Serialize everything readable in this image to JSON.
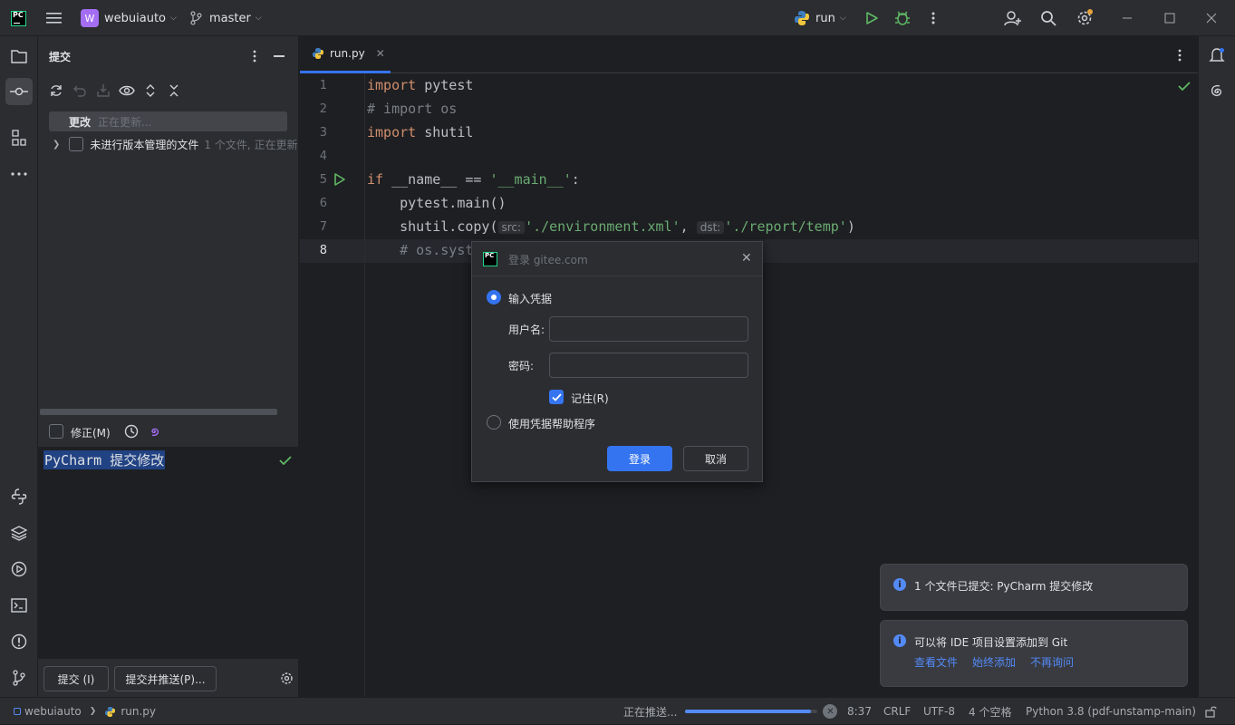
{
  "titlebar": {
    "project_initial": "W",
    "project_name": "webuiauto",
    "branch": "master",
    "run_config": "run"
  },
  "commit_panel": {
    "title": "提交",
    "changes_label": "更改",
    "changes_status": "正在更新...",
    "unversioned_label": "未进行版本管理的文件",
    "unversioned_status": "1 个文件, 正在更新",
    "amend_label": "修正(M)",
    "commit_message": "PyCharm 提交修改",
    "commit_button": "提交 (I)",
    "commit_push_button": "提交并推送(P)..."
  },
  "editor": {
    "tab_name": "run.py",
    "line_numbers": [
      "1",
      "2",
      "3",
      "4",
      "5",
      "6",
      "7",
      "8"
    ],
    "current_line": "8",
    "hints": {
      "src": "src:",
      "dst": "dst:"
    }
  },
  "dialog": {
    "title": "登录 gitee.com",
    "option_credentials": "输入凭据",
    "username_label": "用户名:",
    "password_label": "密码:",
    "remember_label": "记住(R)",
    "option_helper": "使用凭据帮助程序",
    "login_button": "登录",
    "cancel_button": "取消"
  },
  "notifications": {
    "first": "1 个文件已提交: PyCharm 提交修改",
    "second": "可以将 IDE 项目设置添加到 Git",
    "links": [
      "查看文件",
      "始终添加",
      "不再询问"
    ]
  },
  "statusbar": {
    "project": "webuiauto",
    "file": "run.py",
    "progress_text": "正在推送...",
    "progress": 0.95,
    "position": "8:37",
    "line_sep": "CRLF",
    "encoding": "UTF-8",
    "indent": "4 个空格",
    "interpreter": "Python 3.8 (pdf-unstamp-main)"
  },
  "colors": {
    "accent": "#3574f0",
    "run_green": "#5fb865",
    "project_badge": "#a36ef4"
  }
}
